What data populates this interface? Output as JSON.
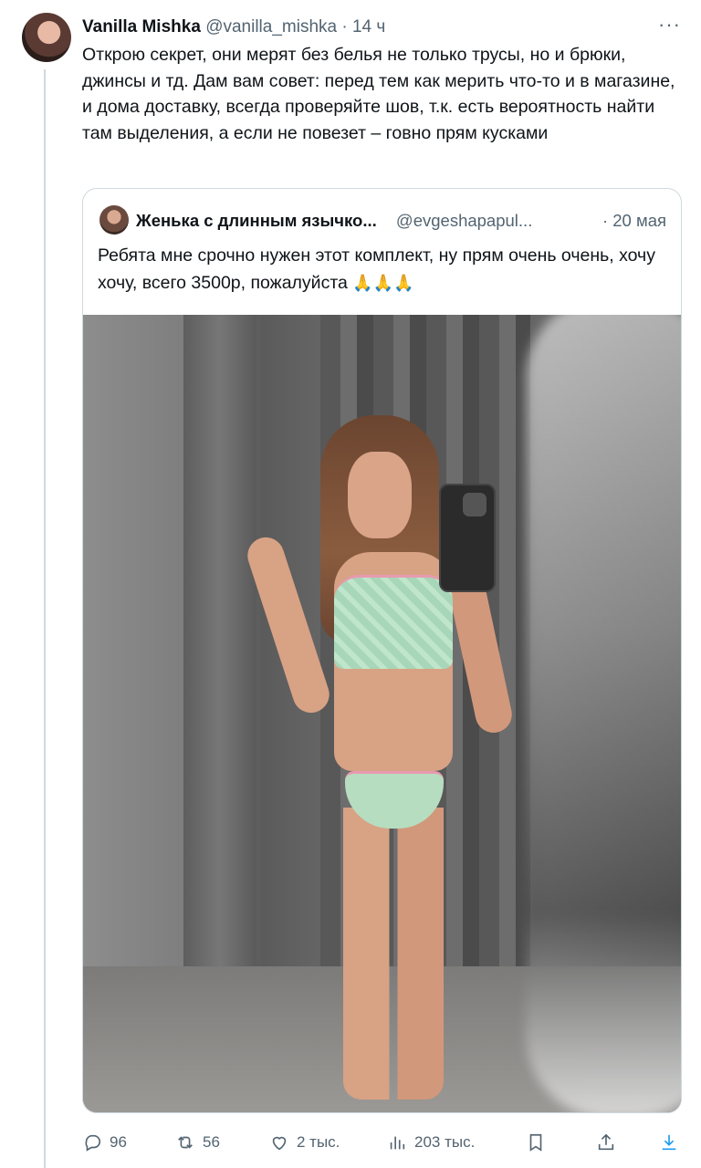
{
  "tweet": {
    "author_name": "Vanilla Mishka",
    "author_handle": "@vanilla_mishka",
    "separator": "·",
    "time": "14 ч",
    "more_label": "···",
    "text": "Открою секрет, они мерят без белья не только трусы, но и брюки, джинсы и тд. Дам вам совет: перед тем как мерить что-то и в магазине, и дома доставку, всегда проверяйте шов, т.к. есть вероятность найти там выделения, а если не повезет – говно прям кусками"
  },
  "quote": {
    "author_name": "Женька с длинным язычко...",
    "author_handle": "@evgeshapapul...",
    "time": "· 20 мая",
    "text": "Ребята мне срочно нужен этот комплект, ну прям очень очень, хочу хочу, всего 3500р, пожалуйста",
    "emoji": "🙏🙏🙏"
  },
  "actions": {
    "replies": "96",
    "retweets": "56",
    "likes": "2 тыс.",
    "views": "203 тыс."
  },
  "icons": [
    "reply-icon",
    "retweet-icon",
    "like-icon",
    "views-icon",
    "bookmark-icon",
    "share-icon",
    "download-icon"
  ],
  "colors": {
    "text": "#0f1419",
    "secondary": "#536471",
    "border": "#cfd9de",
    "accent": "#1d9bf0"
  }
}
